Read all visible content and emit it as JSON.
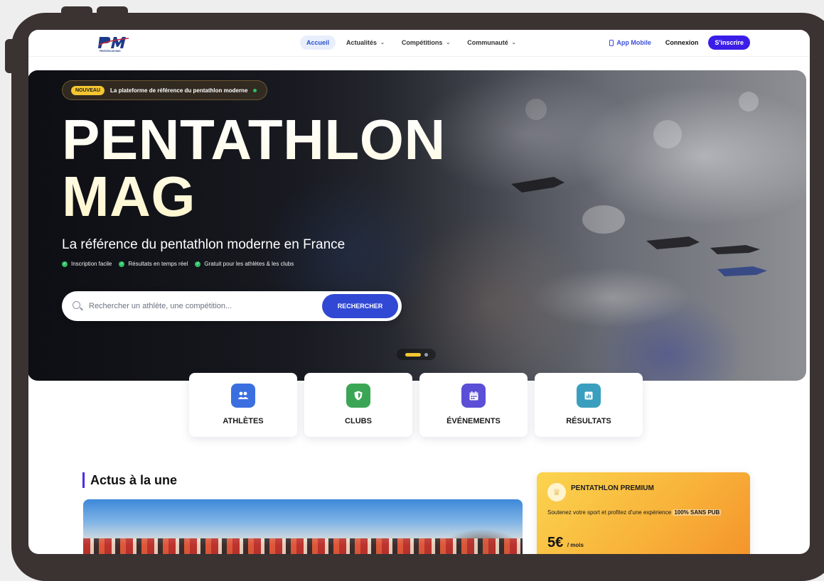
{
  "header": {
    "logo_text": "PM",
    "logo_caption": "PENTATHLON MAG",
    "nav": [
      {
        "label": "Accueil"
      },
      {
        "label": "Actualités"
      },
      {
        "label": "Compétitions"
      },
      {
        "label": "Communauté"
      }
    ],
    "app_mobile": "App Mobile",
    "login": "Connexion",
    "signup": "S'inscrire"
  },
  "hero": {
    "badge_new": "NOUVEAU",
    "badge_text": "La plateforme de référence du pentathlon moderne",
    "title_line1": "PENTATHLON",
    "title_line2": "MAG",
    "subtitle": "La référence du pentathlon moderne en France",
    "features": [
      "Inscription facile",
      "Résultats en temps réel",
      "Gratuit pour les athlètes & les clubs"
    ],
    "search_placeholder": "Rechercher un athlète, une compétition...",
    "search_button": "RECHERCHER",
    "slide_active": 1,
    "slide_count": 2
  },
  "quick_links": [
    {
      "label": "ATHLÈTES",
      "icon": "users-icon",
      "color": "#3b6fe0"
    },
    {
      "label": "CLUBS",
      "icon": "shield-icon",
      "color": "#3aa655"
    },
    {
      "label": "ÉVÉNEMENTS",
      "icon": "calendar-icon",
      "color": "#5a4fd6"
    },
    {
      "label": "RÉSULTATS",
      "icon": "chart-icon",
      "color": "#3a9fbf"
    }
  ],
  "news": {
    "section_title": "Actus à la une"
  },
  "premium": {
    "title": "PENTATHLON PREMIUM",
    "desc": "Soutenez votre sport et profitez d'une expérience",
    "desc_strong": "100% SANS PUB",
    "price": "5€",
    "per": "/ mois"
  },
  "colors": {
    "accent": "#3a1ee8",
    "search_button": "#3048d4",
    "badge": "#f5c630"
  }
}
